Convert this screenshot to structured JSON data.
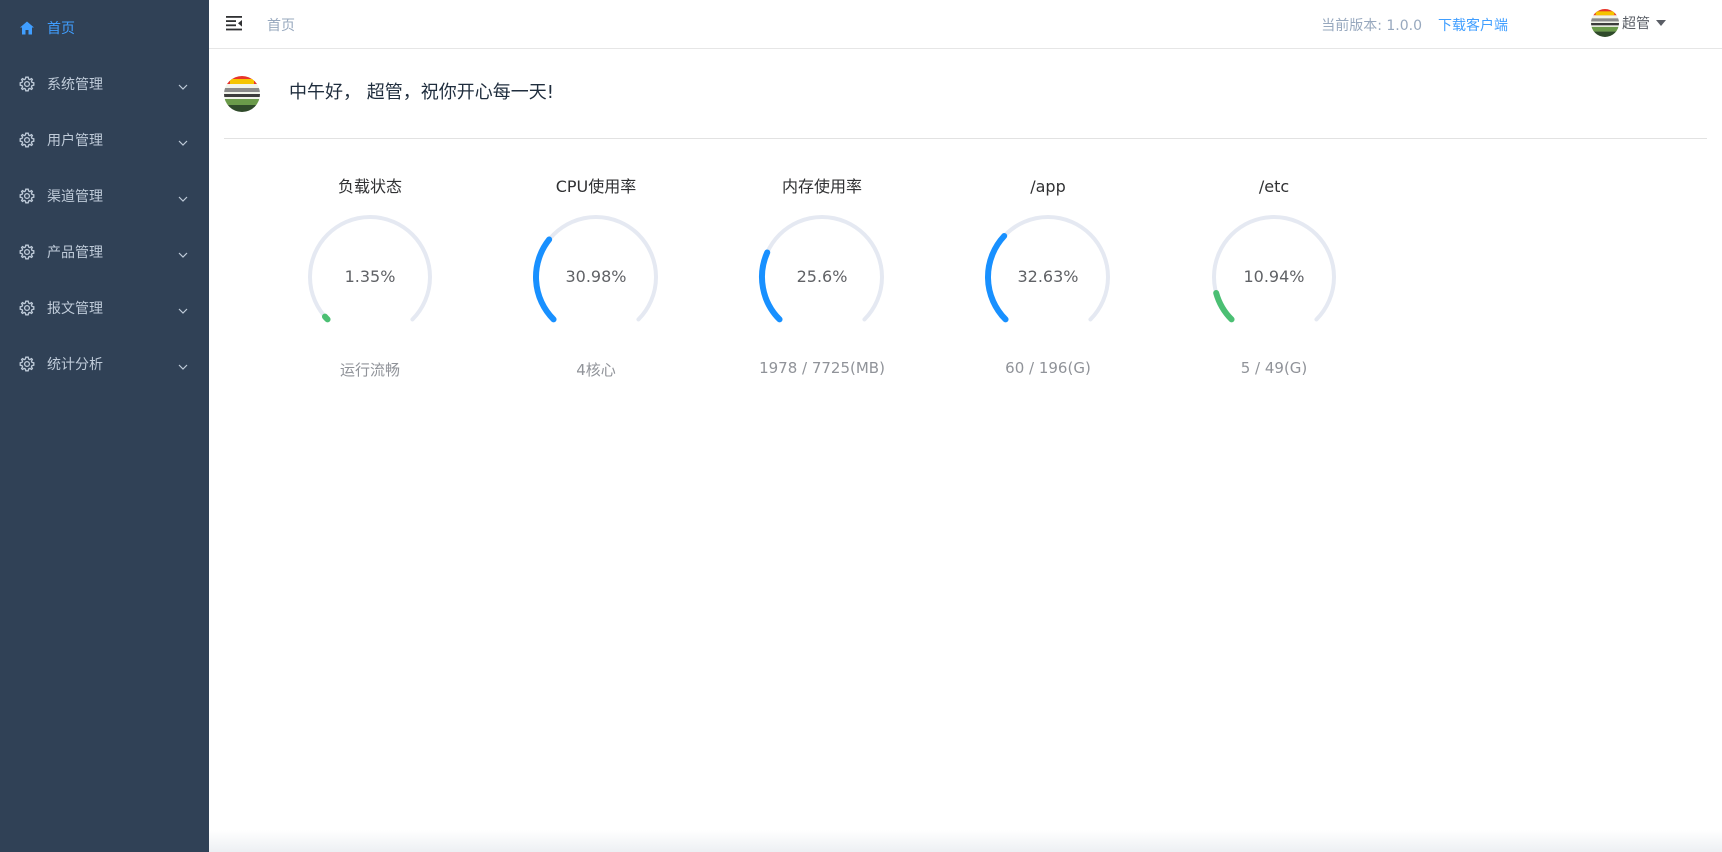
{
  "sidebar": {
    "items": [
      {
        "label": "首页",
        "icon": "home-icon",
        "active": true
      },
      {
        "label": "系统管理",
        "icon": "gear-icon"
      },
      {
        "label": "用户管理",
        "icon": "gear-icon"
      },
      {
        "label": "渠道管理",
        "icon": "gear-icon"
      },
      {
        "label": "产品管理",
        "icon": "gear-icon"
      },
      {
        "label": "报文管理",
        "icon": "gear-icon"
      },
      {
        "label": "统计分析",
        "icon": "gear-icon"
      }
    ]
  },
  "navbar": {
    "breadcrumb": "首页",
    "version_text": "当前版本: 1.0.0",
    "download_label": "下载客户端",
    "user_name": "超管"
  },
  "greeting": {
    "text": "中午好， 超管，祝你开心每一天!"
  },
  "gauges": [
    {
      "title": "负载状态",
      "value_text": "1.35%",
      "value": 1.35,
      "subtitle": "运行流畅",
      "color": "#4bbf73"
    },
    {
      "title": "CPU使用率",
      "value_text": "30.98%",
      "value": 30.98,
      "subtitle": "4核心",
      "color": "#1890ff"
    },
    {
      "title": "内存使用率",
      "value_text": "25.6%",
      "value": 25.6,
      "subtitle": "1978 / 7725(MB)",
      "color": "#1890ff"
    },
    {
      "title": "/app",
      "value_text": "32.63%",
      "value": 32.63,
      "subtitle": "60 / 196(G)",
      "color": "#1890ff"
    },
    {
      "title": "/etc",
      "value_text": "10.94%",
      "value": 10.94,
      "subtitle": "5 / 49(G)",
      "color": "#4bbf73"
    }
  ],
  "colors": {
    "sidebar_bg": "#304156",
    "sidebar_text": "#bfcbd9",
    "accent": "#409eff",
    "gauge_track": "#e5e9f2"
  }
}
